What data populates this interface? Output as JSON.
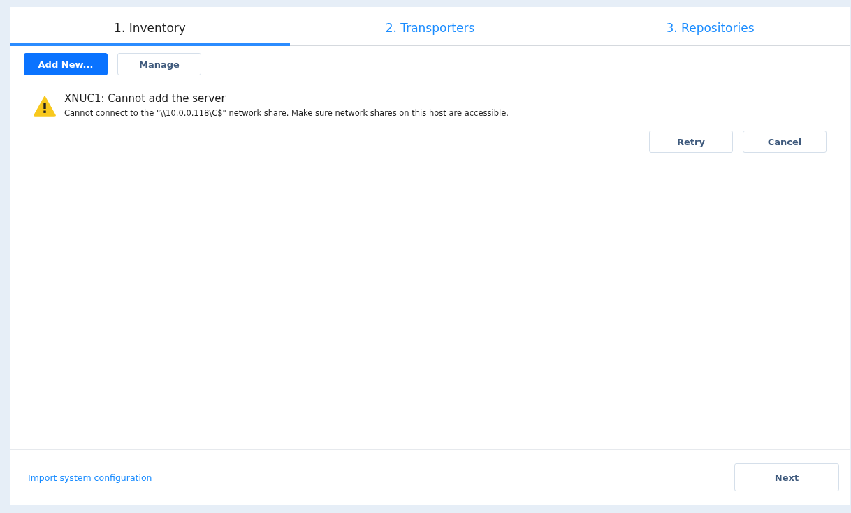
{
  "tabs": [
    {
      "label": "1. Inventory",
      "selected": true
    },
    {
      "label": "2. Transporters",
      "selected": false
    },
    {
      "label": "3. Repositories",
      "selected": false
    }
  ],
  "toolbar": {
    "buttons": [
      {
        "label": "Add New...",
        "kind": "primary"
      },
      {
        "label": "Manage",
        "kind": "secondary"
      }
    ]
  },
  "alert": {
    "kind": "warning",
    "title": "XNUC1: Cannot add the server",
    "message": "Cannot connect to the \"\\\\10.0.0.118\\C$\" network share. Make sure network shares on this host are accessible.",
    "buttons": [
      "Retry",
      "Cancel"
    ]
  },
  "footer": {
    "link": "Import system configuration",
    "button": "Next"
  }
}
